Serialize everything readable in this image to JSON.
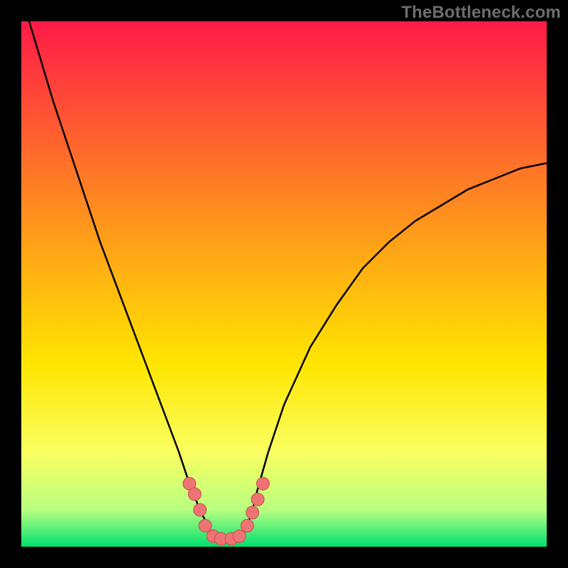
{
  "watermark": "TheBottleneck.com",
  "colors": {
    "frame": "#000000",
    "curve": "#000000",
    "marker_fill": "#ef7373",
    "marker_stroke": "#c34f4f",
    "gradient": [
      {
        "offset": 0.0,
        "color": "#ff1a48"
      },
      {
        "offset": 0.4,
        "color": "#ff9a1a"
      },
      {
        "offset": 0.65,
        "color": "#ffe500"
      },
      {
        "offset": 0.82,
        "color": "#faff60"
      },
      {
        "offset": 0.93,
        "color": "#b8ff80"
      },
      {
        "offset": 1.0,
        "color": "#00e070"
      }
    ]
  },
  "chart_data": {
    "type": "line",
    "title": "",
    "xlabel": "",
    "ylabel": "",
    "xlim": [
      0,
      100
    ],
    "ylim": [
      0,
      100
    ],
    "x": [
      0,
      3,
      6,
      9,
      12,
      15,
      18,
      21,
      24,
      27,
      30,
      32,
      34,
      35,
      36,
      37,
      38,
      39,
      40,
      41,
      42,
      43,
      44,
      45,
      47,
      50,
      55,
      60,
      65,
      70,
      75,
      80,
      85,
      90,
      95,
      100
    ],
    "y": [
      105,
      95,
      85,
      76,
      67,
      58,
      50,
      42,
      34,
      26,
      18,
      12,
      7,
      5,
      3,
      2,
      1,
      1,
      1,
      1,
      2,
      4,
      7,
      11,
      18,
      27,
      38,
      46,
      53,
      58,
      62,
      65,
      68,
      70,
      72,
      73
    ],
    "markers": [
      {
        "x": 32.0,
        "y": 12.0
      },
      {
        "x": 33.0,
        "y": 10.0
      },
      {
        "x": 34.0,
        "y": 7.0
      },
      {
        "x": 35.0,
        "y": 4.0
      },
      {
        "x": 36.5,
        "y": 2.0
      },
      {
        "x": 38.0,
        "y": 1.5
      },
      {
        "x": 40.0,
        "y": 1.5
      },
      {
        "x": 41.5,
        "y": 2.0
      },
      {
        "x": 43.0,
        "y": 4.0
      },
      {
        "x": 44.0,
        "y": 6.5
      },
      {
        "x": 45.0,
        "y": 9.0
      },
      {
        "x": 46.0,
        "y": 12.0
      }
    ],
    "marker_radius_px": 9
  }
}
